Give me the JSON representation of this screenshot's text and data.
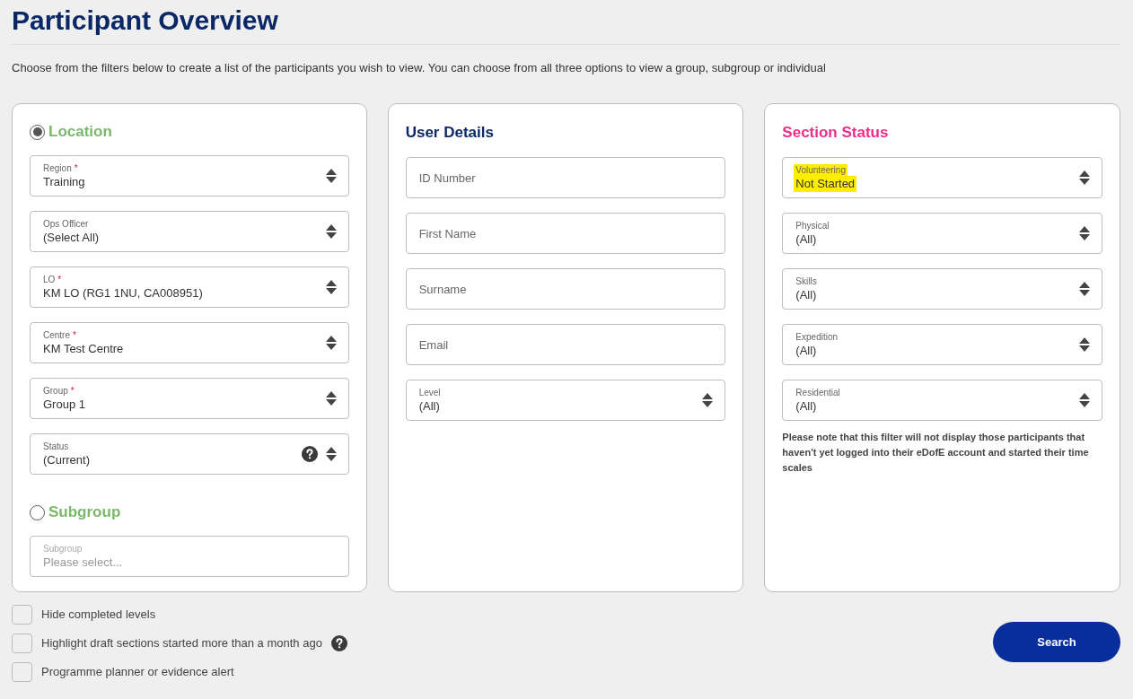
{
  "title": "Participant Overview",
  "description": "Choose from the filters below to create a list of the participants you wish to view. You can choose from all three options to view a group, subgroup or individual",
  "location": {
    "heading": "Location",
    "selected": true,
    "fields": [
      {
        "label": "Region",
        "required_mark": "*",
        "value": "Training",
        "help": false
      },
      {
        "label": "Ops Officer",
        "value": "(Select All)",
        "help": false
      },
      {
        "label": "LO",
        "required_mark": "*",
        "value": "KM LO (RG1 1NU, CA008951)",
        "help": false
      },
      {
        "label": "Centre",
        "required_mark": "*",
        "value": "KM Test Centre",
        "help": false
      },
      {
        "label": "Group",
        "required_mark": "*",
        "value": "Group 1",
        "help": false
      },
      {
        "label": "Status",
        "value": "(Current)",
        "help": true
      }
    ]
  },
  "subgroup": {
    "heading": "Subgroup",
    "selected": false,
    "field": {
      "label": "Subgroup",
      "placeholder": "Please select...",
      "disabled": true
    }
  },
  "user_details": {
    "heading": "User Details",
    "fields": [
      {
        "kind": "input",
        "placeholder": "ID Number"
      },
      {
        "kind": "input",
        "placeholder": "First Name"
      },
      {
        "kind": "input",
        "placeholder": "Surname"
      },
      {
        "kind": "input",
        "placeholder": "Email"
      },
      {
        "kind": "select",
        "label": "Level",
        "value": "(All)"
      }
    ]
  },
  "section_status": {
    "heading": "Section Status",
    "fields": [
      {
        "label": "Volunteering",
        "value": "Not Started",
        "highlighted": true
      },
      {
        "label": "Physical",
        "value": "(All)",
        "highlighted": false
      },
      {
        "label": "Skills",
        "value": "(All)",
        "highlighted": false
      },
      {
        "label": "Expedition",
        "value": "(All)",
        "highlighted": false
      },
      {
        "label": "Residential",
        "value": "(All)",
        "highlighted": false
      }
    ],
    "note": "Please note that this filter will not display those participants that haven't yet logged into their eDofE account and started their time scales"
  },
  "options": [
    {
      "label": "Hide completed levels",
      "checked": false,
      "help": false
    },
    {
      "label": "Highlight draft sections started more than a month ago",
      "checked": false,
      "help": true
    },
    {
      "label": "Programme planner or evidence alert",
      "checked": false,
      "help": false
    }
  ],
  "search_button": "Search"
}
